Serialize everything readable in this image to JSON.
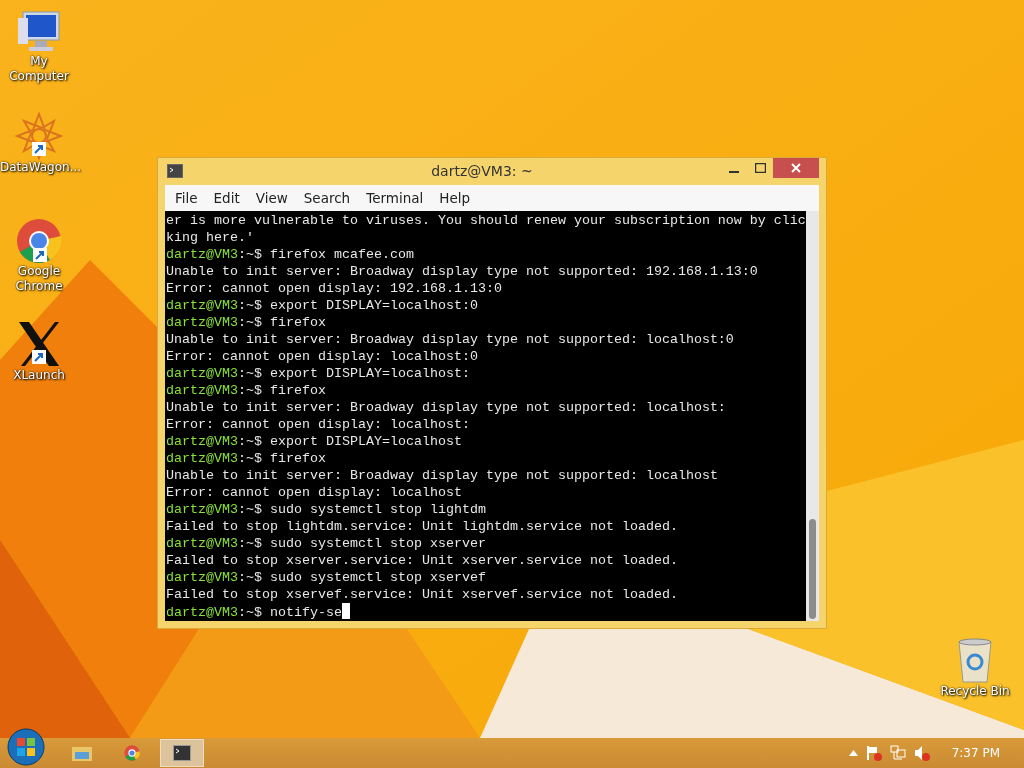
{
  "desktop_icons": [
    {
      "kind": "computer",
      "label": "My Computer",
      "shortcut": false
    },
    {
      "kind": "star",
      "label": "DataWagon...",
      "shortcut": true
    },
    {
      "kind": "chrome",
      "label": "Google Chrome",
      "shortcut": true
    },
    {
      "kind": "x",
      "label": "XLaunch",
      "shortcut": true
    },
    {
      "kind": "bin",
      "label": "Recycle Bin",
      "shortcut": false
    }
  ],
  "window": {
    "title": "dartz@VM3: ~",
    "menu": [
      "File",
      "Edit",
      "View",
      "Search",
      "Terminal",
      "Help"
    ],
    "lines": [
      {
        "kind": "output",
        "text": "er is more vulnerable to viruses. You should renew your subscription now by clic"
      },
      {
        "kind": "output",
        "text": "king here.'"
      },
      {
        "kind": "prompt",
        "user": "dartz@VM3",
        "path": ":~$ ",
        "text": "firefox mcafee.com"
      },
      {
        "kind": "output",
        "text": "Unable to init server: Broadway display type not supported: 192.168.1.13:0"
      },
      {
        "kind": "output",
        "text": "Error: cannot open display: 192.168.1.13:0"
      },
      {
        "kind": "prompt",
        "user": "dartz@VM3",
        "path": ":~$ ",
        "text": "export DISPLAY=localhost:0"
      },
      {
        "kind": "prompt",
        "user": "dartz@VM3",
        "path": ":~$ ",
        "text": "firefox"
      },
      {
        "kind": "output",
        "text": "Unable to init server: Broadway display type not supported: localhost:0"
      },
      {
        "kind": "output",
        "text": "Error: cannot open display: localhost:0"
      },
      {
        "kind": "prompt",
        "user": "dartz@VM3",
        "path": ":~$ ",
        "text": "export DISPLAY=localhost:"
      },
      {
        "kind": "prompt",
        "user": "dartz@VM3",
        "path": ":~$ ",
        "text": "firefox"
      },
      {
        "kind": "output",
        "text": "Unable to init server: Broadway display type not supported: localhost:"
      },
      {
        "kind": "output",
        "text": "Error: cannot open display: localhost:"
      },
      {
        "kind": "prompt",
        "user": "dartz@VM3",
        "path": ":~$ ",
        "text": "export DISPLAY=localhost"
      },
      {
        "kind": "prompt",
        "user": "dartz@VM3",
        "path": ":~$ ",
        "text": "firefox"
      },
      {
        "kind": "output",
        "text": "Unable to init server: Broadway display type not supported: localhost"
      },
      {
        "kind": "output",
        "text": "Error: cannot open display: localhost"
      },
      {
        "kind": "prompt",
        "user": "dartz@VM3",
        "path": ":~$ ",
        "text": "sudo systemctl stop lightdm"
      },
      {
        "kind": "output",
        "text": "Failed to stop lightdm.service: Unit lightdm.service not loaded."
      },
      {
        "kind": "prompt",
        "user": "dartz@VM3",
        "path": ":~$ ",
        "text": "sudo systemctl stop xserver"
      },
      {
        "kind": "output",
        "text": "Failed to stop xserver.service: Unit xserver.service not loaded."
      },
      {
        "kind": "prompt",
        "user": "dartz@VM3",
        "path": ":~$ ",
        "text": "sudo systemctl stop xservef"
      },
      {
        "kind": "output",
        "text": "Failed to stop xservef.service: Unit xservef.service not loaded."
      },
      {
        "kind": "prompt",
        "user": "dartz@VM3",
        "path": ":~$ ",
        "text": "notify-se",
        "cursor": true
      }
    ]
  },
  "taskbar": {
    "apps": [
      {
        "kind": "folder",
        "selected": false
      },
      {
        "kind": "chrome",
        "selected": false
      },
      {
        "kind": "terminal",
        "selected": true
      }
    ],
    "tray": [
      {
        "kind": "arrow"
      },
      {
        "kind": "flag"
      },
      {
        "kind": "network"
      },
      {
        "kind": "speaker"
      }
    ],
    "clock": "7:37 PM"
  }
}
